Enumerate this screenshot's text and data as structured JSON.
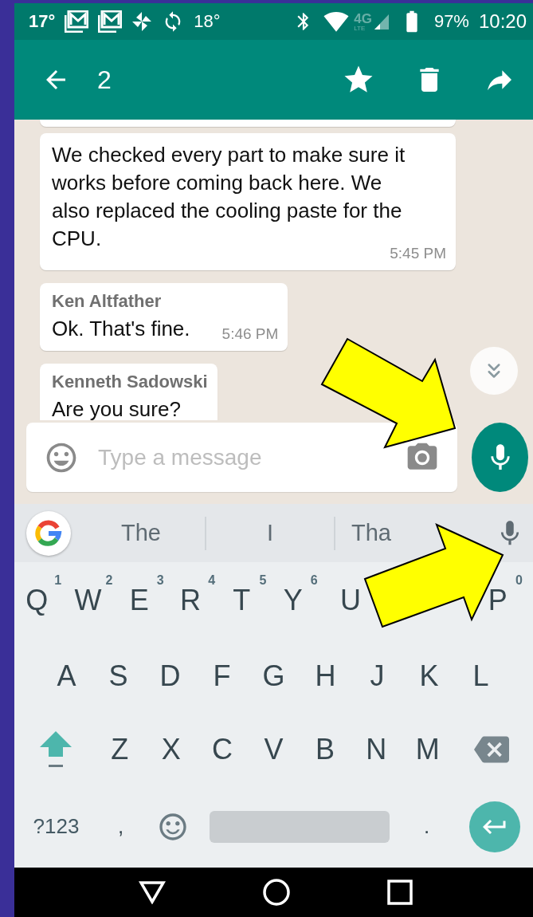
{
  "status_bar": {
    "temperature": "17°",
    "weather": "18°",
    "network": "4G",
    "network_sub": "LTE",
    "battery": "97%",
    "time": "10:20"
  },
  "app_bar": {
    "selected_count": "2"
  },
  "messages": [
    {
      "kind": "fragment"
    },
    {
      "kind": "text",
      "text": "We checked every part to make sure it works before coming back here. We also replaced the cooling paste for the CPU.",
      "time": "5:45 PM"
    },
    {
      "kind": "text",
      "sender": "Ken Altfather",
      "text": "Ok. That's fine.",
      "time": "5:46 PM"
    },
    {
      "kind": "text",
      "sender": "Kenneth Sadowski",
      "text": "Are you sure?"
    }
  ],
  "composer": {
    "placeholder": "Type a message"
  },
  "suggestions": [
    "The",
    "I",
    "Tha"
  ],
  "keyboard": [
    [
      {
        "kind": "letter",
        "label": "Q",
        "hint": "1"
      },
      {
        "kind": "letter",
        "label": "W",
        "hint": "2"
      },
      {
        "kind": "letter",
        "label": "E",
        "hint": "3"
      },
      {
        "kind": "letter",
        "label": "R",
        "hint": "4"
      },
      {
        "kind": "letter",
        "label": "T",
        "hint": "5"
      },
      {
        "kind": "letter",
        "label": "Y",
        "hint": "6"
      },
      {
        "kind": "letter",
        "label": "U"
      },
      {
        "kind": "letter"
      },
      {
        "kind": "letter"
      },
      {
        "kind": "letter",
        "label": "P",
        "hint": "0"
      }
    ],
    [
      {
        "kind": "letter",
        "label": "A"
      },
      {
        "kind": "letter",
        "label": "S"
      },
      {
        "kind": "letter",
        "label": "D"
      },
      {
        "kind": "letter",
        "label": "F"
      },
      {
        "kind": "letter",
        "label": "G"
      },
      {
        "kind": "letter",
        "label": "H"
      },
      {
        "kind": "letter",
        "label": "J"
      },
      {
        "kind": "letter",
        "label": "K"
      },
      {
        "kind": "letter",
        "label": "L"
      }
    ],
    [
      {
        "kind": "shift",
        "on": true
      },
      {
        "kind": "letter",
        "label": "Z"
      },
      {
        "kind": "letter",
        "label": "X"
      },
      {
        "kind": "letter",
        "label": "C"
      },
      {
        "kind": "letter",
        "label": "V"
      },
      {
        "kind": "letter",
        "label": "B"
      },
      {
        "kind": "letter",
        "label": "N"
      },
      {
        "kind": "letter",
        "label": "M"
      },
      {
        "kind": "backspace"
      }
    ],
    [
      {
        "kind": "symbols",
        "label": "?123"
      },
      {
        "kind": "punct",
        "label": ","
      },
      {
        "kind": "emoji"
      },
      {
        "kind": "space"
      },
      {
        "kind": "punct",
        "label": "."
      },
      {
        "kind": "enter"
      }
    ]
  ],
  "annotations": [
    {
      "kind": "arrow"
    },
    {
      "kind": "arrow"
    }
  ]
}
